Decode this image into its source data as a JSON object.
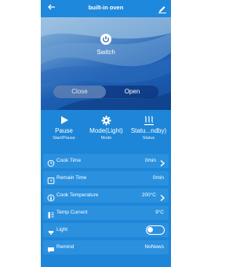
{
  "header": {
    "title": "built-in oven",
    "back_icon": "back-arrow-icon",
    "edit_icon": "edit-pencil-icon"
  },
  "hero": {
    "switch_label": "Switch",
    "close_label": "Close",
    "open_label": "Open",
    "selected": "Close"
  },
  "controls": [
    {
      "icon": "play-icon",
      "value": "Pause",
      "caption": "Start/Pause"
    },
    {
      "icon": "gear-icon",
      "value": "Mode(Light)",
      "caption": "Mode"
    },
    {
      "icon": "steam-icon",
      "value": "Statu...ndby)",
      "caption": "Status"
    }
  ],
  "rows": [
    {
      "icon": "clock-icon",
      "label": "Cook Time",
      "value": "0min",
      "chevron": true
    },
    {
      "icon": "alarm-icon",
      "label": "Remain Time",
      "value": "0min",
      "chevron": false
    },
    {
      "icon": "thermometer-icon",
      "label": "Cook Temperature",
      "value": "200°C",
      "chevron": true
    },
    {
      "icon": "temp-gauge-icon",
      "label": "Temp Current",
      "value": "9°C",
      "chevron": false
    },
    {
      "icon": "lamp-icon",
      "label": "Light",
      "value": "",
      "toggle": true,
      "toggle_on": false
    },
    {
      "icon": "chat-icon",
      "label": "Remind",
      "value": "NoNews",
      "chevron": false
    }
  ],
  "colors": {
    "background": "#1d86d8",
    "row": "#2b91df",
    "text": "#ffffff"
  }
}
